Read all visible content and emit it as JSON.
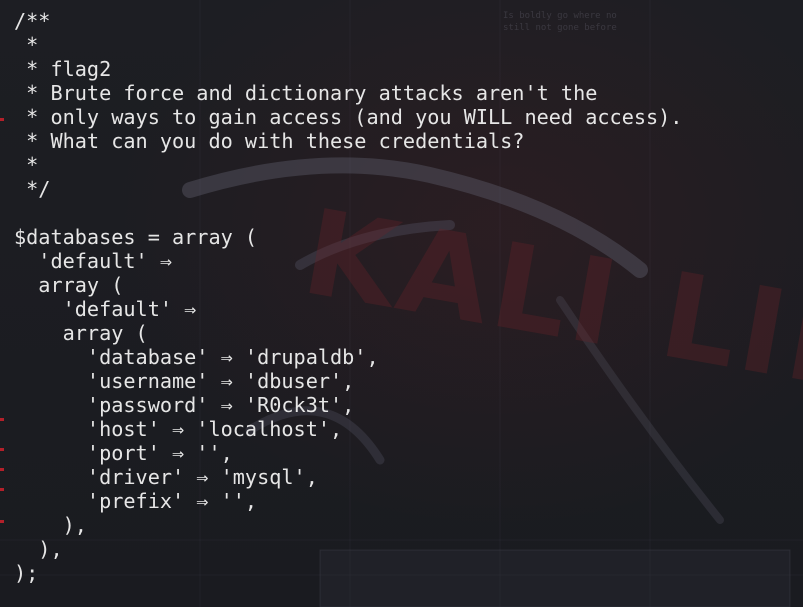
{
  "terminal": {
    "lines": [
      "/**",
      " *",
      " * flag2",
      " * Brute force and dictionary attacks aren't the",
      " * only ways to gain access (and you WILL need access).",
      " * What can you do with these credentials?",
      " *",
      " */",
      "",
      "$databases = array (",
      "  'default' ⇒",
      "  array (",
      "    'default' ⇒",
      "    array (",
      "      'database' ⇒ 'drupaldb',",
      "      'username' ⇒ 'dbuser',",
      "      'password' ⇒ 'R0ck3t',",
      "      'host' ⇒ 'localhost',",
      "      'port' ⇒ '',",
      "      'driver' ⇒ 'mysql',",
      "      'prefix' ⇒ '',",
      "    ),",
      "  ),",
      ");"
    ]
  },
  "wallpaper": {
    "logo_text": "KALI LINUX",
    "small_text": "Is boldly go where no\nstill not gone before",
    "accent_color": "#b3202a",
    "background_color": "#1c1d22",
    "text_color": "#e6e6e6"
  }
}
